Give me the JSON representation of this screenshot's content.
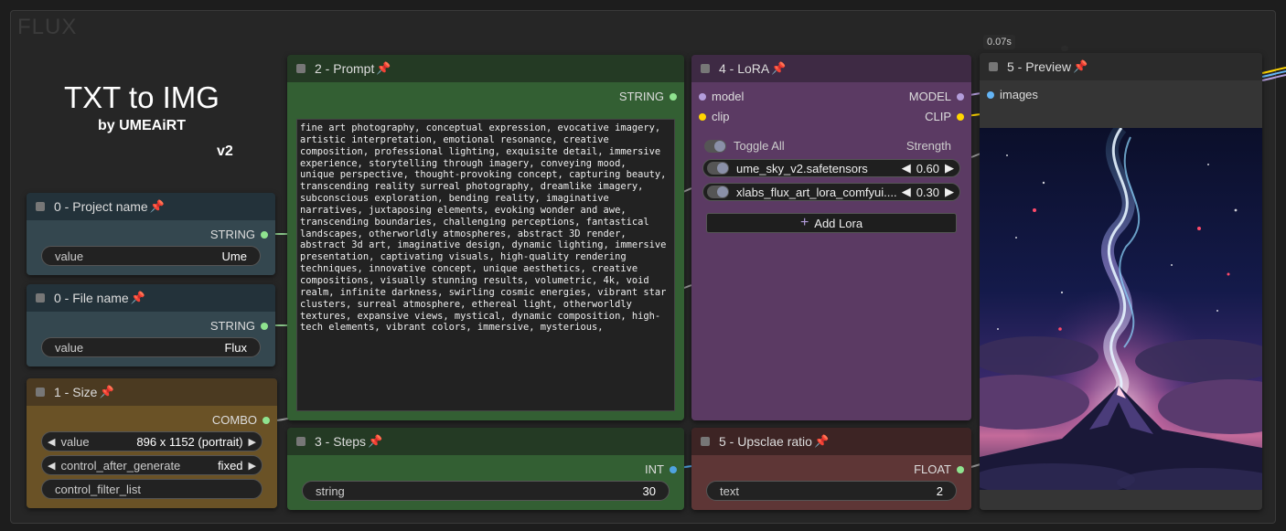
{
  "group": {
    "title": "FLUX"
  },
  "hero": {
    "title": "TXT to IMG",
    "by": "by UMEAiRT",
    "version": "v2"
  },
  "timings": [
    "0.07s",
    "0.07s"
  ],
  "nodes": {
    "project": {
      "title": "0 - Project name",
      "output": "STRING",
      "widget_label": "value",
      "widget_value": "Ume"
    },
    "file": {
      "title": "0 - File name",
      "output": "STRING",
      "widget_label": "value",
      "widget_value": "Flux"
    },
    "size": {
      "title": "1 - Size",
      "output": "COMBO",
      "value_label": "value",
      "value_value": "896 x 1152  (portrait)",
      "control_label": "control_after_generate",
      "control_value": "fixed",
      "filter_label": "control_filter_list"
    },
    "prompt": {
      "title": "2 - Prompt",
      "output": "STRING",
      "text": "fine art photography, conceptual expression, evocative imagery, artistic interpretation, emotional resonance, creative composition, professional lighting, exquisite detail, immersive experience, storytelling through imagery, conveying mood,  unique perspective, thought-provoking concept, capturing beauty, transcending reality surreal photography, dreamlike imagery, subconscious exploration, bending reality, imaginative narratives, juxtaposing elements, evoking wonder and awe, transcending boundaries, challenging perceptions, fantastical landscapes, otherworldly atmospheres, abstract 3D render, abstract 3d art, imaginative design, dynamic lighting, immersive presentation, captivating visuals, high-quality rendering techniques, innovative concept, unique aesthetics, creative compositions, visually stunning results, volumetric, 4k, void realm, infinite darkness, swirling cosmic energies, vibrant star clusters, surreal atmosphere, ethereal light, otherworldly textures, expansive views, mystical, dynamic composition, high-tech elements, vibrant colors, immersive, mysterious,"
    },
    "steps": {
      "title": "3 - Steps",
      "output": "INT",
      "widget_label": "string",
      "widget_value": "30"
    },
    "lora": {
      "title": "4 - LoRA",
      "inputs": [
        "model",
        "clip"
      ],
      "outputs": [
        "MODEL",
        "CLIP"
      ],
      "toggle_all": "Toggle All",
      "strength_label": "Strength",
      "loras": [
        {
          "name": "ume_sky_v2.safetensors",
          "strength": "0.60"
        },
        {
          "name": "xlabs_flux_art_lora_comfyui....",
          "strength": "0.30"
        }
      ],
      "add_label": "Add Lora"
    },
    "upscale": {
      "title": "5 - Upsclae ratio",
      "output": "FLOAT",
      "widget_label": "text",
      "widget_value": "2"
    },
    "preview": {
      "title": "5 - Preview",
      "input": "images"
    }
  },
  "colors": {
    "slot_string": "#8fe38f",
    "slot_model": "#b39ddb",
    "slot_clip": "#ffd500",
    "slot_int": "#4fa3e0",
    "slot_image": "#64b5f6",
    "pin": "#e03a4a"
  }
}
